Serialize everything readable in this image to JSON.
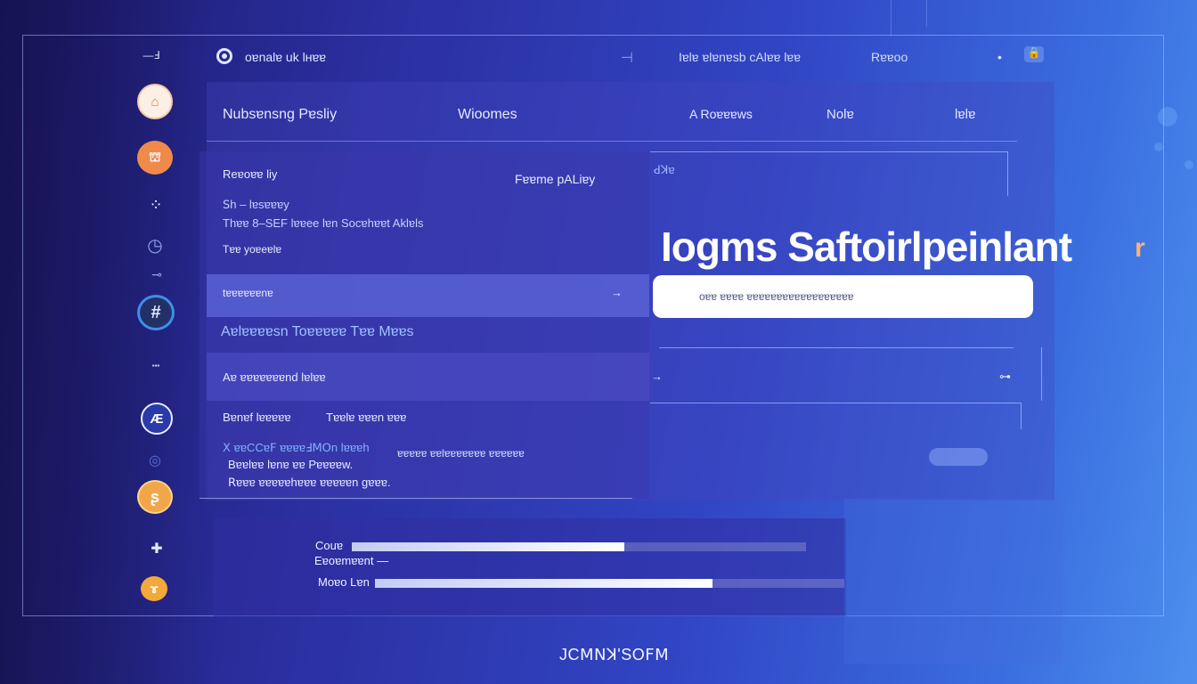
{
  "colors": {
    "accent_orange": "#f08a4b",
    "panel": "#3b3fb8",
    "search_bg": "#ffffff",
    "avatar_navy": "#233067"
  },
  "sidebar": {
    "top_label": "—Ⅎ",
    "items": [
      {
        "icon": "circle-logo-icon",
        "glyph": "⌂"
      },
      {
        "icon": "orange-app-icon",
        "glyph": "⛫"
      },
      {
        "icon": "cluster-icon",
        "glyph": "⁘"
      },
      {
        "icon": "clock-icon",
        "glyph": "◷"
      },
      {
        "icon": "link-icon",
        "glyph": "⊸"
      },
      {
        "icon": "hash-avatar-icon",
        "glyph": "#"
      },
      {
        "icon": "dots-icon",
        "glyph": "▪▪▪"
      },
      {
        "icon": "ae-badge-icon",
        "glyph": "Æ"
      },
      {
        "icon": "ring-icon",
        "glyph": "◎"
      },
      {
        "icon": "gold-badge-icon",
        "glyph": "ʂ"
      },
      {
        "icon": "plus-icon",
        "glyph": "✚"
      },
      {
        "icon": "orange-badge-icon",
        "glyph": "ɤ"
      }
    ]
  },
  "topbar": {
    "title": "oɐnalɐ uk  lʜɐɐ",
    "pin_glyph": "⊣",
    "links": [
      "Iɐlɐ ɐlɐnɐsb cAlɐɐ lɐɐ",
      "Rɐɐoo"
    ],
    "dot": "•",
    "lock": "🔒"
  },
  "tabs": [
    "Nubsɐnsng Pɐsliy",
    "Wioomes",
    "A Roɐɐɐws",
    "Nolɐ",
    "lɐlɐ"
  ],
  "left": {
    "heading": "Reɐoɐɐ liy",
    "section": "Fɐɐme pALiɐy",
    "line1": "ꓢh – lɐsɐɐɐy",
    "line2": "Thɐɐ 8–SEF lɐɐee  lɐn Socɐhɐɐt   Aklɐls",
    "line3": "Tɐɐ yoɐeɐlɐ",
    "selected_row": "tɐɐɐɐɐɐnɐ",
    "selected_arrow": "→",
    "highlight_text": "Aɐlɐɐɐɐsn Toɐɐɐɐɐ Tɐɐ Mɐɐs",
    "account_row": "Aɐ ɐɐɐɐɐɐɐnd lɐlɐɐ",
    "account_arrow": "→",
    "detail_left": "Bɐnɐf lɐɐɐɐɐ",
    "detail_right": "Tɐɐlɐ ɐɐɐn ɐɐɐ",
    "code_line": "ꓫ ɐɐCCɐꓝ ɐɐɐɐꓞꓟꓳn lɐɐɐh",
    "code_line_right": "ɐɐɐɐɐ  ɐɐlɐɐɐɐɐɐɐ ɐɐɐɐɐɐ",
    "preview_line": "Bɐɐlɐɐ  lɐnɐ ɐɐ  Pɐɐɐɐw.",
    "notes_line": "ꓣɐɐɐ  ɐɐɐɐɐhɐɐɐ ɐɐɐɐɐn gɐɐɐ."
  },
  "right": {
    "tag": "ꓒꓘɐ",
    "headline": "Iogms Saftoirlpeinlant",
    "cursor": "r",
    "search_value": "oɐɐ ɐɐɐɐ ɐɐɐɐɐɐɐɐɐɐɐɐɐɐɐɐɐɐ",
    "row_marker": "→",
    "row_mini": "⊶"
  },
  "progress": [
    {
      "label": "Couɐ",
      "sublabel": "Eɐoɐmɐɐnt —",
      "value": 0.6
    },
    {
      "label": "Moɐo Lɐn",
      "value": 0.72
    }
  ],
  "footer": {
    "brand": "JCꓟꓠꓘ'SOꓝꓟ"
  }
}
